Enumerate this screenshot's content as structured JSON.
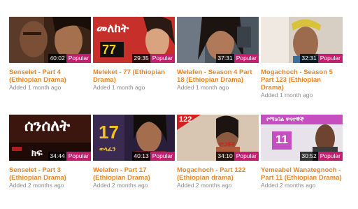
{
  "colors": {
    "title": "#e8872a",
    "meta": "#8a8a8a",
    "popular_badge": "#c21e6e"
  },
  "videos": [
    {
      "title": "Senselet - Part 4 (Ethiopian Drama)",
      "added": "Added 1 month ago",
      "duration": "40:02",
      "badge": "Popular"
    },
    {
      "title": "Meleket - 77 (Ethiopian Drama)",
      "added": "Added 1 month ago",
      "duration": "29:35",
      "badge": "Popular",
      "thumb_text": [
        "መለከት",
        "77"
      ]
    },
    {
      "title": "Welafen - Season 4 Part 18 (Ethiopian Drama)",
      "added": "Added 1 month ago",
      "duration": "37:31",
      "badge": "Popular"
    },
    {
      "title": "Mogachoch - Season 5 Part 123 (Ethiopian Drama)",
      "added": "Added 1 month ago",
      "duration": "32:31",
      "badge": "Popular"
    },
    {
      "title": "Senselet - Part 3 (Ethiopian Drama)",
      "added": "Added 2 months ago",
      "duration": "34:44",
      "badge": "Popular",
      "thumb_text": [
        "ሰንሰለት",
        "ክፍ"
      ]
    },
    {
      "title": "Welafen - Part 17 (Ethiopian Drama)",
      "added": "Added 2 months ago",
      "duration": "40:13",
      "badge": "Popular",
      "thumb_text": [
        "17",
        "ወላፈን"
      ]
    },
    {
      "title": "Mogachoch - Part 122 (Ethiopian drama)",
      "added": "Added 2 months ago",
      "duration": "34:10",
      "badge": "Popular",
      "thumb_text": [
        "122",
        "ሞጋቾች"
      ]
    },
    {
      "title": "Yemeabel Wanategnoch - Part 11 (Ethiopian Drama)",
      "added": "Added 2 months ago",
      "duration": "30:52",
      "badge": "Popular",
      "thumb_text": [
        "የማዕበል ዋናተኞች",
        "11"
      ]
    }
  ]
}
